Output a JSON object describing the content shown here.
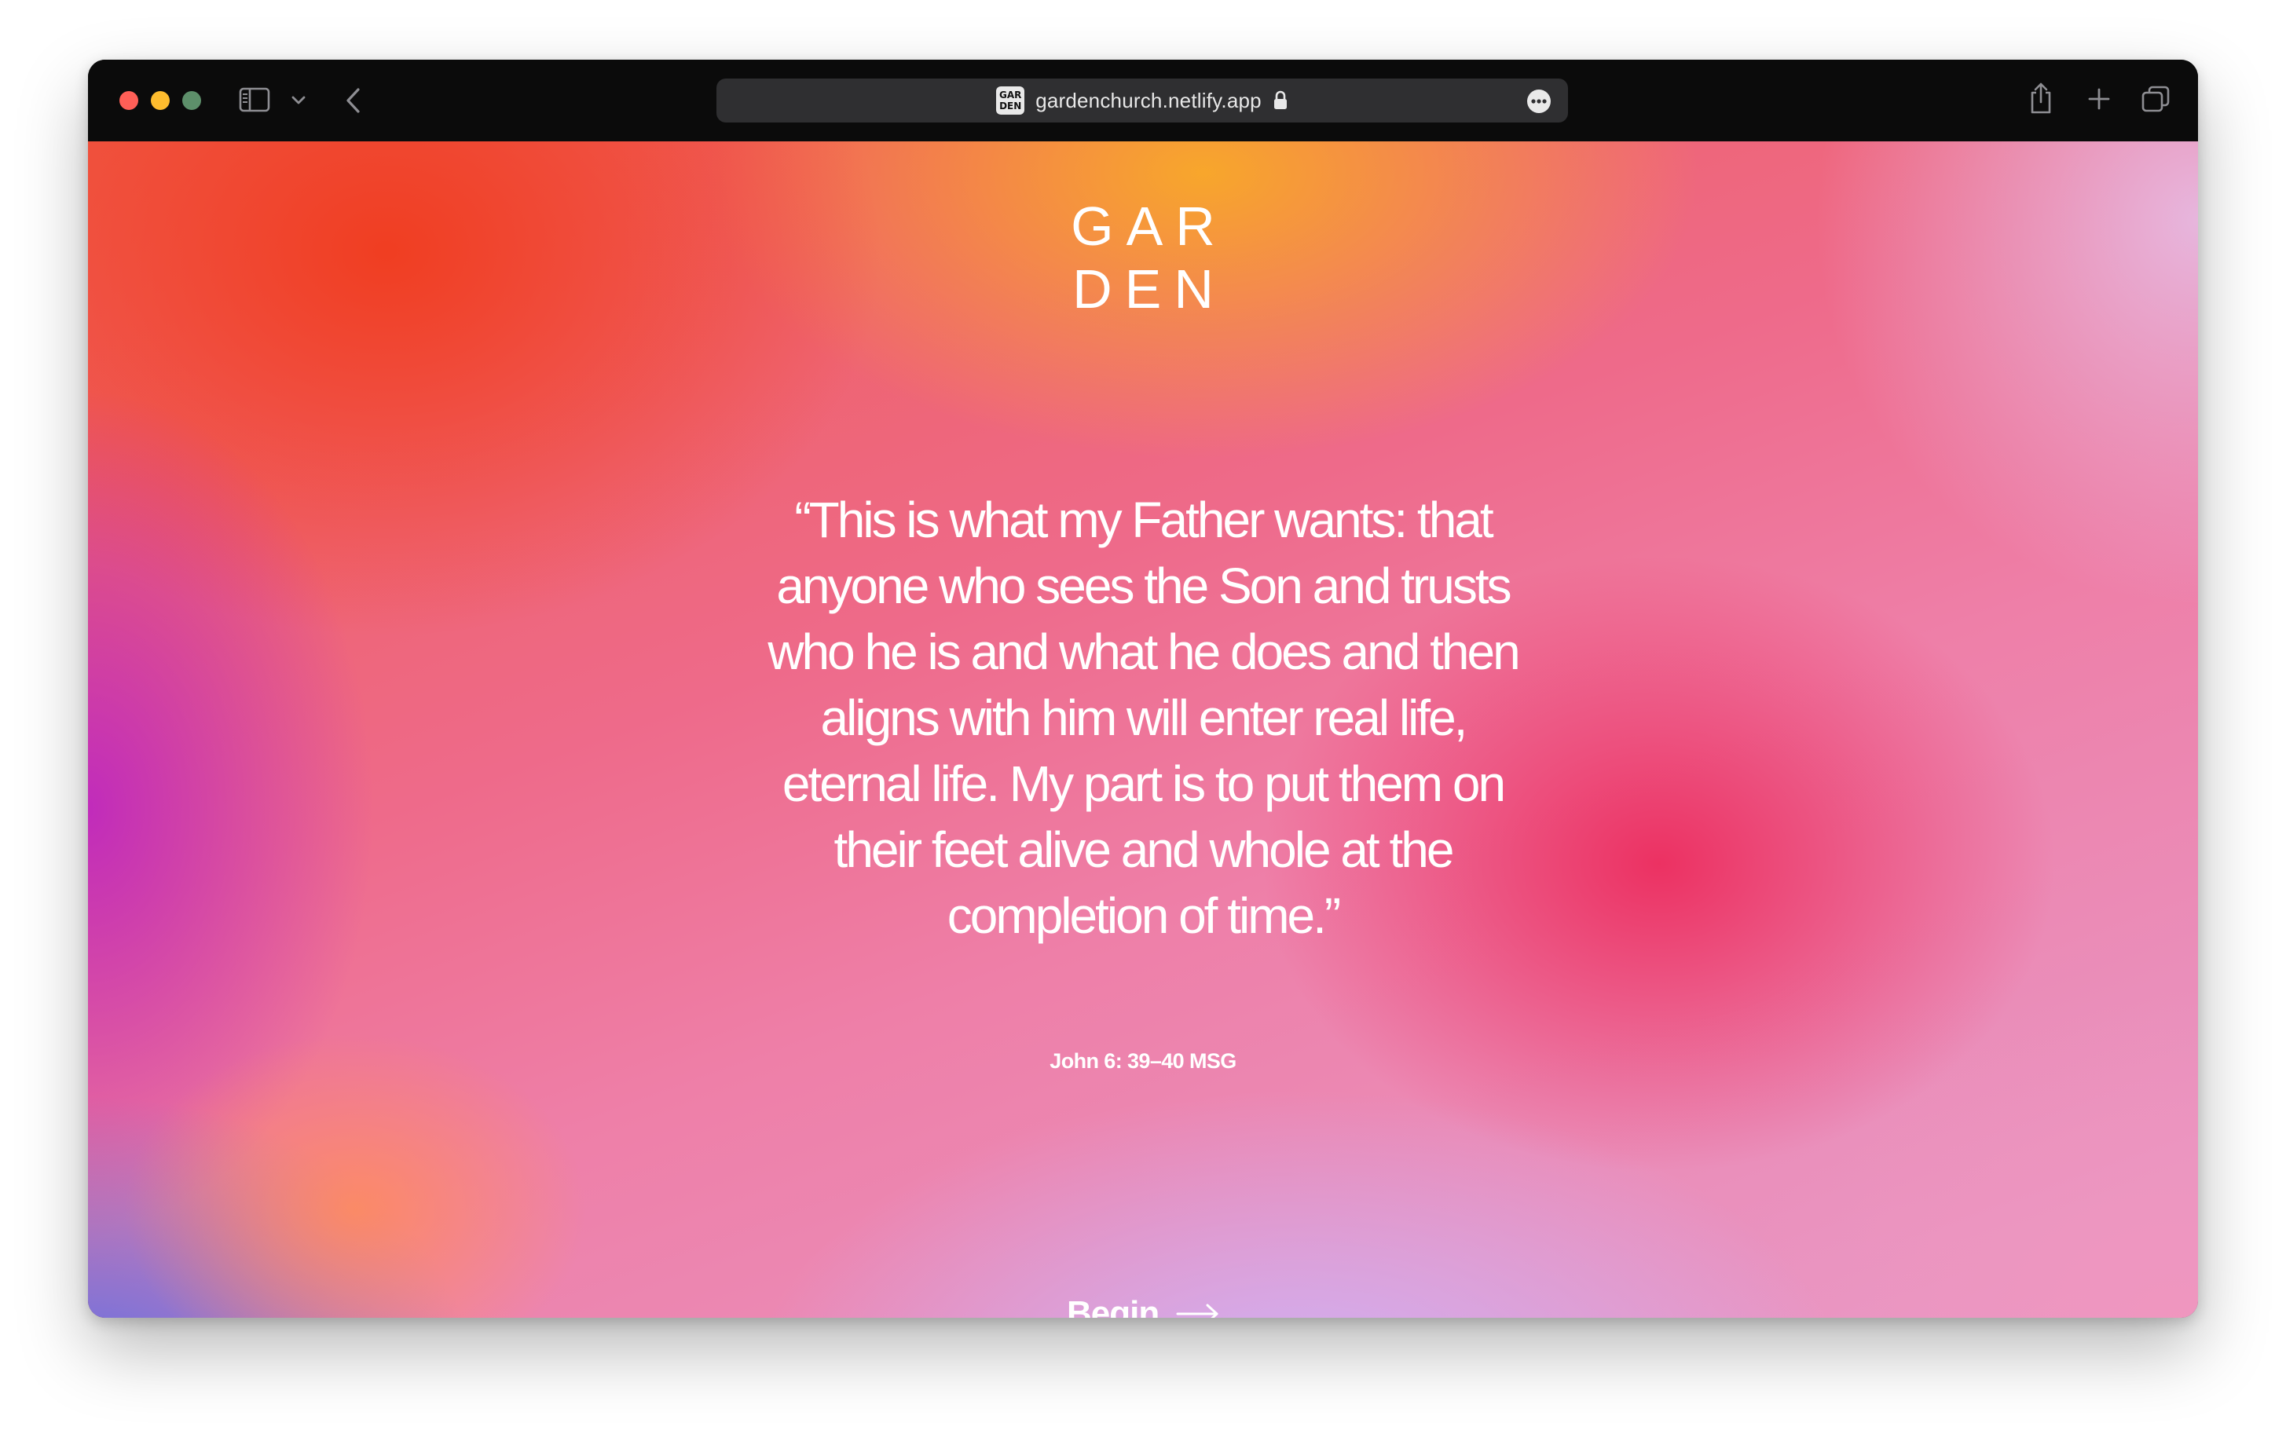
{
  "browser": {
    "url": "gardenchurch.netlify.app",
    "favicon_text": [
      "GAR",
      "DEN"
    ],
    "icons": {
      "sidebar": "sidebar-icon",
      "sidebar_menu": "chevron-down-icon",
      "back": "back-chevron-icon",
      "lock": "lock-icon",
      "page_menu": "more-icon",
      "share": "share-icon",
      "new_tab": "plus-icon",
      "tab_overview": "tabs-icon"
    }
  },
  "page": {
    "logo_lines": [
      "GAR",
      "DEN"
    ],
    "quote": "“This is what my Father wants: that anyone who sees the Son and trusts who he is and what he does and then aligns with him will enter real life, eternal life. My part is to put them on their feet alive and whole at the completion of time.”",
    "reference": "John 6: 39–40 MSG",
    "cta": {
      "label": "Begin",
      "icon": "arrow-right-icon"
    }
  },
  "colors": {
    "text": "#ffffff",
    "toolbar": "#0b0b0b",
    "urlbar": "#2f2f31"
  }
}
